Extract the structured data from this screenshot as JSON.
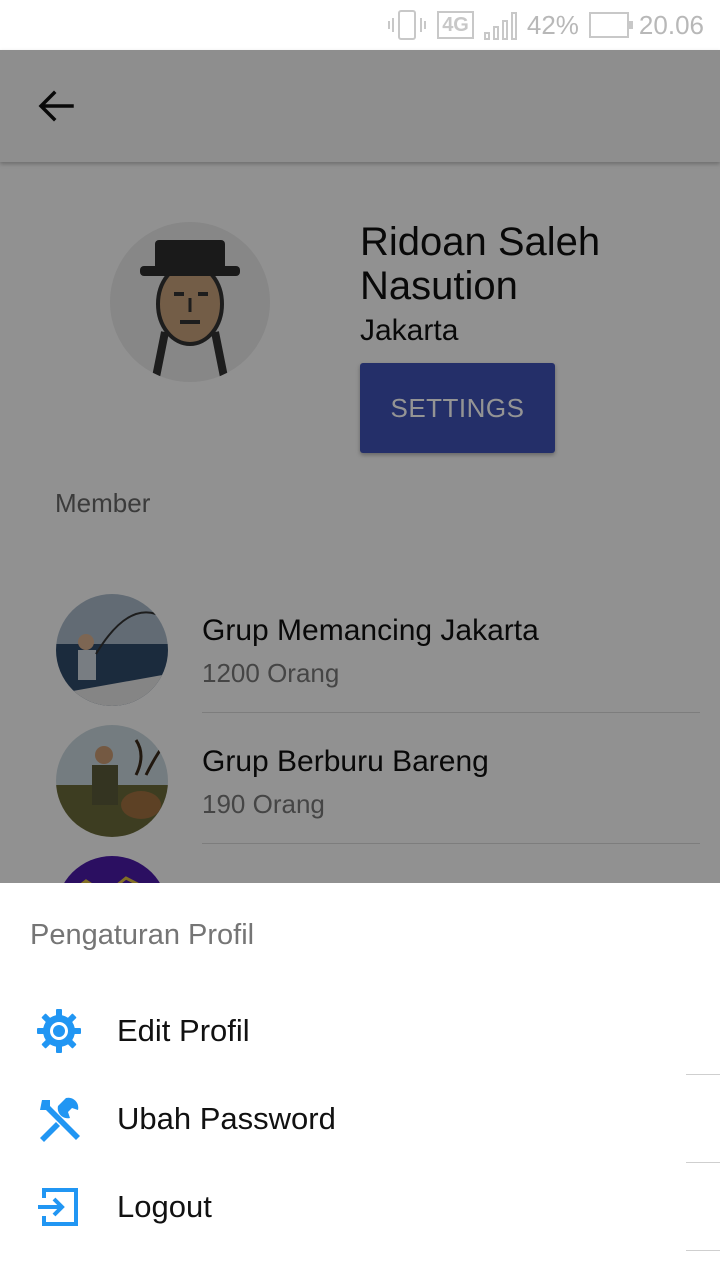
{
  "status_bar": {
    "network": "4G",
    "battery": "42%",
    "time": "20.06"
  },
  "appbar": {
    "back_icon": "arrow-back-icon"
  },
  "profile": {
    "name": "Ridoan Saleh Nasution",
    "city": "Jakarta",
    "settings_label": "SETTINGS",
    "member_label": "Member"
  },
  "groups": [
    {
      "title": "Grup Memancing Jakarta",
      "count": "1200 Orang"
    },
    {
      "title": "Grup Berburu Bareng",
      "count": "190 Orang"
    },
    {
      "title": "",
      "count": ""
    }
  ],
  "sheet": {
    "title": "Pengaturan Profil",
    "items": [
      {
        "label": "Edit Profil",
        "icon": "gear-icon"
      },
      {
        "label": "Ubah Password",
        "icon": "tools-icon"
      },
      {
        "label": "Logout",
        "icon": "logout-icon"
      }
    ]
  },
  "colors": {
    "accent": "#3f51b5",
    "icon_blue": "#2196f3"
  }
}
